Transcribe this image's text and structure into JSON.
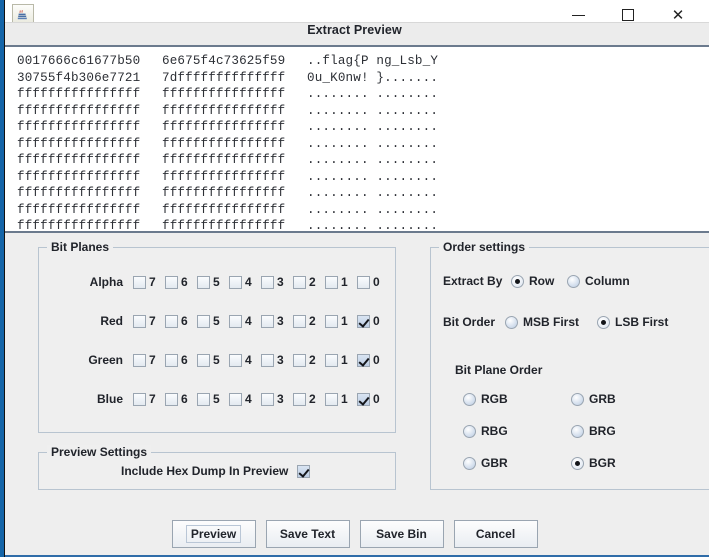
{
  "window": {
    "title": "Extract Preview",
    "icon": "java-coffee-cup-icon",
    "minimize_label": "—",
    "maximize_label": "□",
    "close_label": "✕"
  },
  "hexdump": {
    "rows": [
      {
        "hex1": "0017666c61677b50",
        "hex2": "6e675f4c73625f59",
        "ascii": "..flag{P ng_Lsb_Y"
      },
      {
        "hex1": "30755f4b306e7721",
        "hex2": "7dffffffffffffff",
        "ascii": "0u_K0nw! }......."
      },
      {
        "hex1": "ffffffffffffffff",
        "hex2": "ffffffffffffffff",
        "ascii": "........ ........"
      },
      {
        "hex1": "ffffffffffffffff",
        "hex2": "ffffffffffffffff",
        "ascii": "........ ........"
      },
      {
        "hex1": "ffffffffffffffff",
        "hex2": "ffffffffffffffff",
        "ascii": "........ ........"
      },
      {
        "hex1": "ffffffffffffffff",
        "hex2": "ffffffffffffffff",
        "ascii": "........ ........"
      },
      {
        "hex1": "ffffffffffffffff",
        "hex2": "ffffffffffffffff",
        "ascii": "........ ........"
      },
      {
        "hex1": "ffffffffffffffff",
        "hex2": "ffffffffffffffff",
        "ascii": "........ ........"
      },
      {
        "hex1": "ffffffffffffffff",
        "hex2": "ffffffffffffffff",
        "ascii": "........ ........"
      },
      {
        "hex1": "ffffffffffffffff",
        "hex2": "ffffffffffffffff",
        "ascii": "........ ........"
      },
      {
        "hex1": "ffffffffffffffff",
        "hex2": "ffffffffffffffff",
        "ascii": "........ ........"
      }
    ]
  },
  "bit_planes": {
    "title": "Bit Planes",
    "bits": [
      "7",
      "6",
      "5",
      "4",
      "3",
      "2",
      "1",
      "0"
    ],
    "channels": [
      {
        "label": "Alpha",
        "checked": [
          false,
          false,
          false,
          false,
          false,
          false,
          false,
          false
        ]
      },
      {
        "label": "Red",
        "checked": [
          false,
          false,
          false,
          false,
          false,
          false,
          false,
          true
        ]
      },
      {
        "label": "Green",
        "checked": [
          false,
          false,
          false,
          false,
          false,
          false,
          false,
          true
        ]
      },
      {
        "label": "Blue",
        "checked": [
          false,
          false,
          false,
          false,
          false,
          false,
          false,
          true
        ]
      }
    ]
  },
  "order_settings": {
    "title": "Order settings",
    "extract_by": {
      "label": "Extract By",
      "options": [
        "Row",
        "Column"
      ],
      "selected": "Row"
    },
    "bit_order": {
      "label": "Bit Order",
      "options": [
        "MSB First",
        "LSB First"
      ],
      "selected": "LSB First"
    },
    "bit_plane_order": {
      "label": "Bit Plane Order",
      "options": [
        "RGB",
        "GRB",
        "RBG",
        "BRG",
        "GBR",
        "BGR"
      ],
      "selected": "BGR"
    }
  },
  "preview_settings": {
    "title": "Preview Settings",
    "include_hex_dump": {
      "label": "Include Hex Dump In Preview",
      "checked": true
    }
  },
  "buttons": [
    {
      "label": "Preview",
      "focused": true
    },
    {
      "label": "Save Text",
      "focused": false
    },
    {
      "label": "Save Bin",
      "focused": false
    },
    {
      "label": "Cancel",
      "focused": false
    }
  ]
}
